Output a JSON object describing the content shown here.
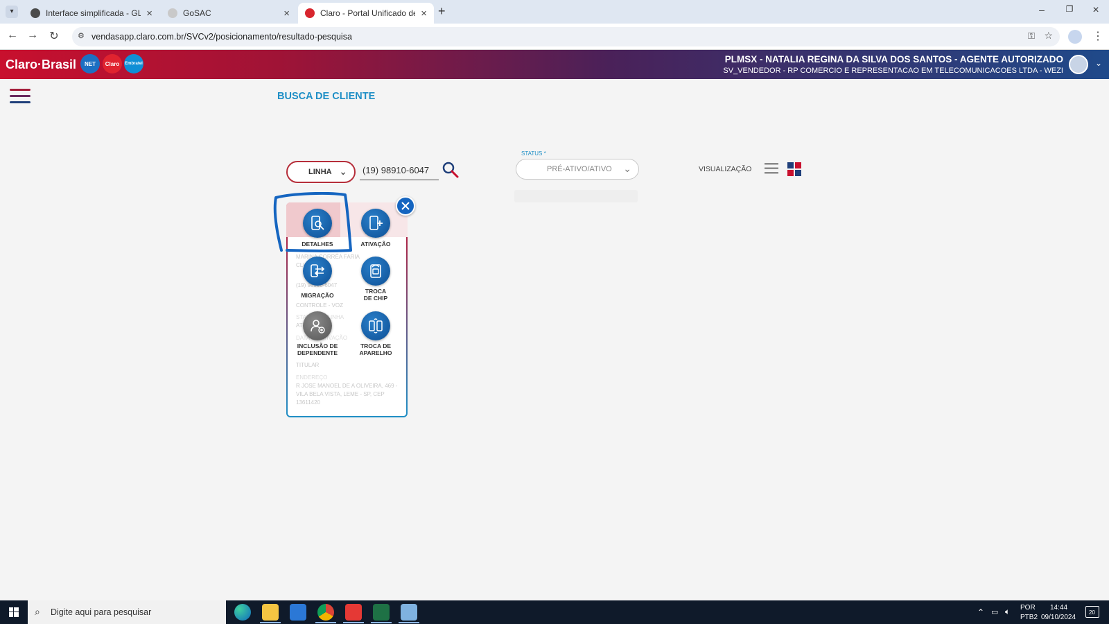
{
  "browser": {
    "tabs": [
      {
        "title": "Interface simplificada - GLPI",
        "active": false
      },
      {
        "title": "GoSAC",
        "active": false
      },
      {
        "title": "Claro - Portal Unificado de Ven",
        "active": true
      }
    ],
    "url": "vendasapp.claro.com.br/SVCv2/posicionamento/resultado-pesquisa"
  },
  "header": {
    "brand": "Claro·Brasil",
    "brand_logos": [
      "NET",
      "Claro",
      "Embratel"
    ],
    "user_name": "PLMSX - NATALIA REGINA DA SILVA DOS SANTOS - AGENTE AUTORIZADO",
    "user_sub": "SV_VENDEDOR - RP COMERCIO E REPRESENTACAO EM TELECOMUNICACOES LTDA - WEZI"
  },
  "page": {
    "title": "BUSCA DE CLIENTE",
    "search_type": "LINHA",
    "search_value": "(19) 98910-6047",
    "status_label": "STATUS *",
    "status_value": "PRÉ-ATIVO/ATIVO",
    "visualization_label": "VISUALIZAÇÃO"
  },
  "card_faded": {
    "line1": "MARINA CORRÊA FARIA",
    "line2": "CLIENTE",
    "line3": "(19) 98910-6047",
    "line4": "CONTROLE - VOZ",
    "line5": "STATUS DA LINHA",
    "line6": "ATIVO",
    "line7": "DATA DE ATIVAÇÃO",
    "line8": "TITULAR",
    "addr_label": "ENDEREÇO",
    "addr1": "R JOSE MANOEL DE A OLIVEIRA, 469 -",
    "addr2": "VILA BELA VISTA, LEME - SP, CEP",
    "addr3": "13611420"
  },
  "actions": [
    {
      "label": "DETALHES"
    },
    {
      "label": "ATIVAÇÃO"
    },
    {
      "label": "MIGRAÇÃO"
    },
    {
      "label": "TROCA DE CHIP",
      "line1": "TROCA",
      "line2": "DE CHIP"
    },
    {
      "label": "INCLUSÃO DE DEPENDENTE",
      "line1": "INCLUSÃO DE",
      "line2": "DEPENDENTE"
    },
    {
      "label": "TROCA DE APARELHO",
      "line1": "TROCA DE",
      "line2": "APARELHO"
    }
  ],
  "taskbar": {
    "search_placeholder": "Digite aqui para pesquisar",
    "lang1": "POR",
    "lang2": "PTB2",
    "time": "14:44",
    "date": "09/10/2024",
    "notifications": "20"
  },
  "colors": {
    "accent_blue": "#1f8fc6",
    "claro_red": "#c8102e",
    "action_blue": "#0d4f95",
    "highlight_pen": "#1565c0"
  }
}
